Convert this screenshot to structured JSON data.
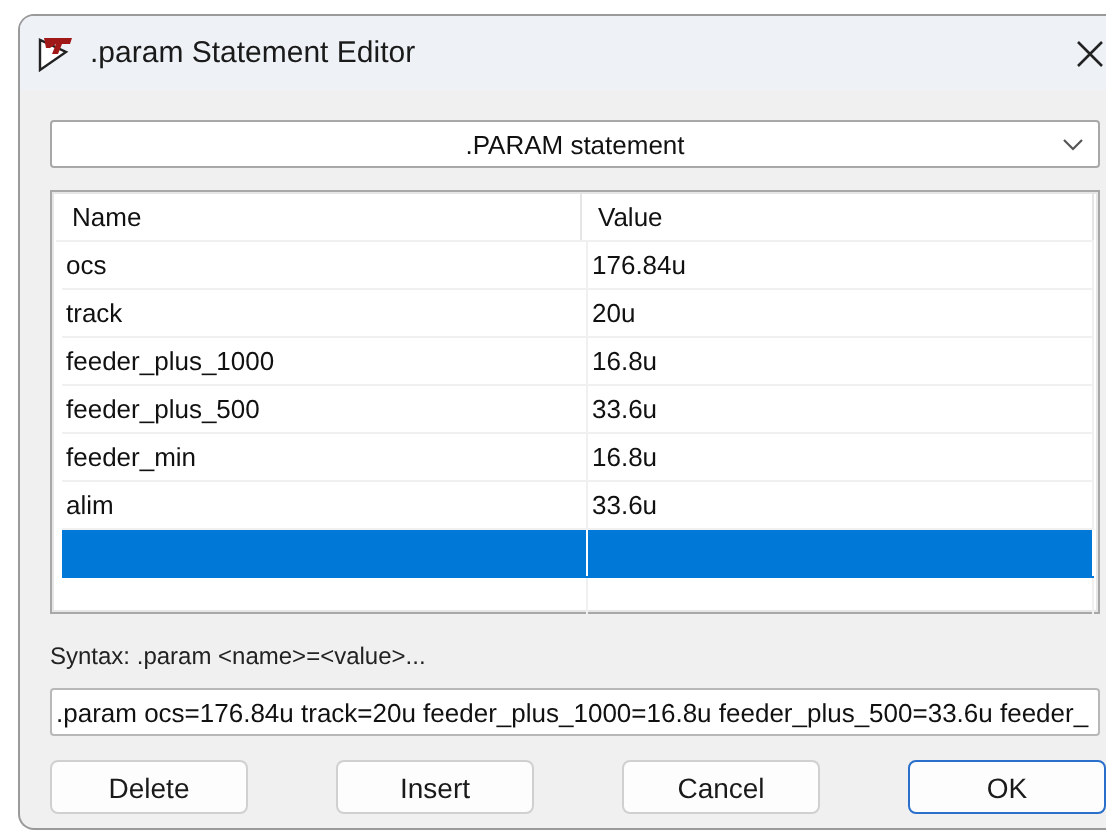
{
  "window": {
    "title": ".param Statement Editor"
  },
  "statement_type": {
    "value": ".PARAM statement"
  },
  "table": {
    "columns": [
      "Name",
      "Value"
    ],
    "rows": [
      {
        "name": "ocs",
        "value": "176.84u",
        "selected": false
      },
      {
        "name": "track",
        "value": "20u",
        "selected": false
      },
      {
        "name": "feeder_plus_1000",
        "value": "16.8u",
        "selected": false
      },
      {
        "name": "feeder_plus_500",
        "value": "33.6u",
        "selected": false
      },
      {
        "name": "feeder_min",
        "value": "16.8u",
        "selected": false
      },
      {
        "name": "alim",
        "value": "33.6u",
        "selected": false
      },
      {
        "selected": true
      }
    ]
  },
  "syntax_hint": "Syntax: .param <name>=<value>...",
  "statement_field": {
    "value": ".param ocs=176.84u track=20u feeder_plus_1000=16.8u feeder_plus_500=33.6u feeder_"
  },
  "buttons": [
    {
      "label": "Delete",
      "default": false
    },
    {
      "label": "Insert",
      "default": false
    },
    {
      "label": "Cancel",
      "default": false
    },
    {
      "label": "OK",
      "default": true
    }
  ]
}
